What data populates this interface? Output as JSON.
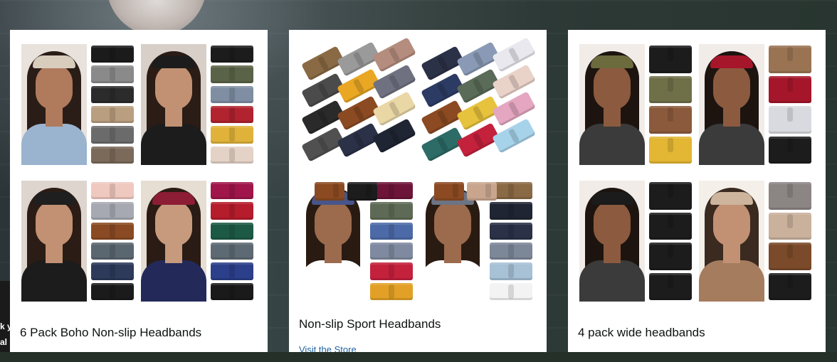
{
  "background": {
    "caption_lines": [
      "k y",
      "al"
    ]
  },
  "cards": [
    {
      "title": "6 Pack Boho Non-slip Headbands",
      "tiles": [
        {
          "photo": {
            "bg": "#e9e2dc",
            "hair": "#2a1d17",
            "band": "#d8cdbd",
            "shirt": "#9ab3cf",
            "skin": "#b07a5d"
          },
          "swatches": [
            "#1b1b1b",
            "#8a8a8a",
            "#2b2b2b",
            "#b99e7f",
            "#6b6b6b",
            "#7b6a5a"
          ]
        },
        {
          "photo": {
            "bg": "#d7cfc8",
            "hair": "#2b1c15",
            "band": "#1c1c1c",
            "shirt": "#1c1c1c",
            "skin": "#c29173"
          },
          "swatches": [
            "#1c1c1c",
            "#5a6347",
            "#7f8ea3",
            "#b0232f",
            "#e0b23a",
            "#e4d2c6"
          ]
        },
        {
          "photo": {
            "bg": "#ddd5ce",
            "hair": "#2b1c15",
            "band": "#1f1f1f",
            "shirt": "#1c1c1c",
            "skin": "#c29173"
          },
          "swatches": [
            "#efc8c0",
            "#a7a9b2",
            "#8a4b24",
            "#5a6670",
            "#2d3a5a",
            "#1b1b1b"
          ]
        },
        {
          "photo": {
            "bg": "#e6ddd3",
            "hair": "#2a1b14",
            "band": "#8c1d34",
            "shirt": "#232a5a",
            "skin": "#c79a7d"
          },
          "swatches": [
            "#a0164a",
            "#b51c2c",
            "#1d5a45",
            "#5e6a73",
            "#2b3f8a",
            "#1a1a1a"
          ]
        }
      ]
    },
    {
      "title": "Non-slip Sport Headbands",
      "link": "Visit the Store",
      "flatlays": [
        {
          "bands": [
            "#8a6a44",
            "#9a9a9a",
            "#b58d7e",
            "#4b4b4b",
            "#e9a724",
            "#6f7181",
            "#2a2a2a",
            "#8b4a22",
            "#e9d7a6",
            "#505050",
            "#2b3147",
            "#1f2533"
          ]
        },
        {
          "bands": [
            "#2b3147",
            "#8a9ab6",
            "#e8e8ee",
            "#2c3b63",
            "#5a6b58",
            "#e9d2c8",
            "#8b4a22",
            "#e7c23d",
            "#e4a6c0",
            "#2c6b66",
            "#c4213d",
            "#a7d3ea"
          ]
        }
      ],
      "tiles": [
        {
          "photo": {
            "bg": "#ffffff",
            "hair": "#2a1b12",
            "band": "#47558a",
            "shirt": "#ffffff",
            "skin": "#9c6a4d"
          },
          "top_bands": [
            "#8b4a22",
            "#1c1c1c"
          ],
          "swatches": [
            "#6d1538",
            "#5e6a55",
            "#4d6aa8",
            "#7f8aa0",
            "#c4213d",
            "#e2a126"
          ]
        },
        {
          "photo": {
            "bg": "#ffffff",
            "hair": "#2a1b12",
            "band": "#6c7484",
            "shirt": "#ffffff",
            "skin": "#9c6a4d"
          },
          "top_bands": [
            "#8b4a22",
            "#c9a58e"
          ],
          "swatches": [
            "#8a6a44",
            "#1f2533",
            "#2b3147",
            "#7c8798",
            "#a7c1d6",
            "#f3f3f3"
          ]
        }
      ]
    },
    {
      "title": "4 pack wide headbands",
      "tiles": [
        {
          "photo": {
            "bg": "#f1ece8",
            "hair": "#1d1410",
            "band": "#6b6b3e",
            "shirt": "#3b3b3b",
            "skin": "#8c5a3f"
          },
          "swatches": [
            "#1c1c1c",
            "#6f7048",
            "#8b5a3c",
            "#e3b633"
          ]
        },
        {
          "photo": {
            "bg": "#f1ece8",
            "hair": "#1d1410",
            "band": "#a6162b",
            "shirt": "#3b3b3b",
            "skin": "#8c5a3f"
          },
          "swatches": [
            "#9a7452",
            "#a6162b",
            "#d9dadf",
            "#1c1c1c"
          ]
        },
        {
          "photo": {
            "bg": "#f1ece8",
            "hair": "#1d1410",
            "band": "#1b1b1b",
            "shirt": "#3b3b3b",
            "skin": "#8c5a3f"
          },
          "swatches": [
            "#1c1c1c",
            "#1c1c1c",
            "#1c1c1c",
            "#1c1c1c"
          ]
        },
        {
          "photo": {
            "bg": "#f4efe9",
            "hair": "#3a2a20",
            "band": "#cdb49c",
            "shirt": "#a57c5e",
            "skin": "#c29173"
          },
          "swatches": [
            "#8b8584",
            "#c9b19c",
            "#7a4a2a",
            "#1c1c1c"
          ]
        }
      ]
    }
  ]
}
